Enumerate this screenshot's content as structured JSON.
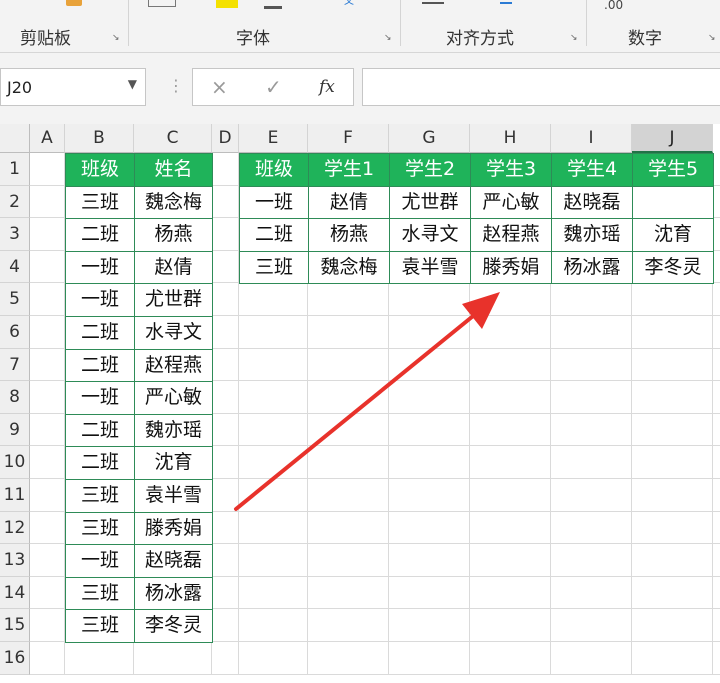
{
  "ribbon": {
    "groups": [
      "剪贴板",
      "字体",
      "对齐方式",
      "数字"
    ],
    "partial_number_format": ".00"
  },
  "formula_bar": {
    "name_box": "J20",
    "cancel_icon": "×",
    "enter_icon": "✓",
    "fx_label": "fx",
    "formula": ""
  },
  "sheet": {
    "columns": [
      "A",
      "B",
      "C",
      "D",
      "E",
      "F",
      "G",
      "H",
      "I",
      "J"
    ],
    "rows": [
      "1",
      "2",
      "3",
      "4",
      "5",
      "6",
      "7",
      "8",
      "9",
      "10",
      "11",
      "12",
      "13",
      "14",
      "15",
      "16"
    ],
    "selected_column": "J",
    "left_table": {
      "headers": [
        "班级",
        "姓名"
      ],
      "rows": [
        [
          "三班",
          "魏念梅"
        ],
        [
          "二班",
          "杨燕"
        ],
        [
          "一班",
          "赵倩"
        ],
        [
          "一班",
          "尤世群"
        ],
        [
          "二班",
          "水寻文"
        ],
        [
          "二班",
          "赵程燕"
        ],
        [
          "一班",
          "严心敏"
        ],
        [
          "二班",
          "魏亦瑶"
        ],
        [
          "二班",
          "沈育"
        ],
        [
          "三班",
          "袁半雪"
        ],
        [
          "三班",
          "滕秀娟"
        ],
        [
          "一班",
          "赵晓磊"
        ],
        [
          "三班",
          "杨冰露"
        ],
        [
          "三班",
          "李冬灵"
        ]
      ]
    },
    "right_table": {
      "headers": [
        "班级",
        "学生1",
        "学生2",
        "学生3",
        "学生4",
        "学生5"
      ],
      "rows": [
        [
          "一班",
          "赵倩",
          "尤世群",
          "严心敏",
          "赵晓磊",
          ""
        ],
        [
          "二班",
          "杨燕",
          "水寻文",
          "赵程燕",
          "魏亦瑶",
          "沈育"
        ],
        [
          "三班",
          "魏念梅",
          "袁半雪",
          "滕秀娟",
          "杨冰露",
          "李冬灵"
        ]
      ]
    },
    "accent_colors": {
      "header_fill": "#1fb35a",
      "border": "#2e8b57",
      "arrow": "#e8322b"
    }
  }
}
